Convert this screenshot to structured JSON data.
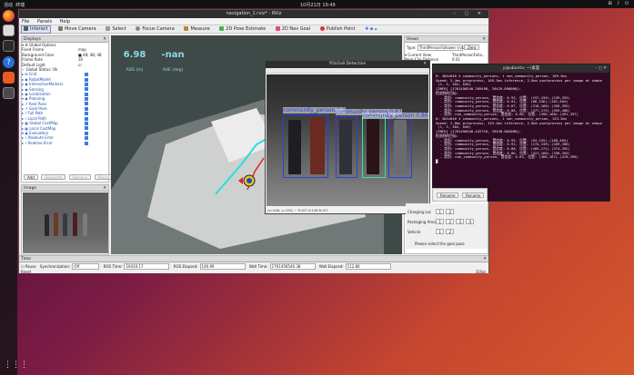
{
  "topbar": {
    "activities": "活动",
    "app": "终端",
    "clock": "10月21日 19:49",
    "tray": "⊞ ♪ ⏻"
  },
  "dock": {
    "apps_grid": "⋮⋮⋮"
  },
  "rviz": {
    "title": "navigation_1.rviz* - RViz",
    "window_controls": "– ▢ ✕",
    "menu": [
      "File",
      "Panels",
      "Help"
    ],
    "toolbar": [
      "Interact",
      "Move Camera",
      "Select",
      "Focus Camera",
      "Measure",
      "2D Pose Estimate",
      "2D Nav Goal",
      "Publish Point"
    ],
    "displays": {
      "title": "Displays",
      "rows": [
        {
          "label": "▾ ⚙ Global Options",
          "val": ""
        },
        {
          "label": "      Fixed Frame",
          "val": "map"
        },
        {
          "label": "      Background Color",
          "val": "■ 48; 48; 48"
        },
        {
          "label": "      Frame Rate",
          "val": "30"
        },
        {
          "label": "      Default Light",
          "val": "☑"
        },
        {
          "label": "  ✓ Global Status: Ok",
          "val": ""
        },
        {
          "label": "▸ ⊞ Grid",
          "val": ""
        },
        {
          "label": "▸ ◉ RobotModel",
          "val": ""
        },
        {
          "label": "▸ ◉ InteractiveMarkers",
          "val": ""
        },
        {
          "label": "▸ ◉ Sensing",
          "val": ""
        },
        {
          "label": "▸ ◉ Localization",
          "val": ""
        },
        {
          "label": "▾ ◉ Planning",
          "val": ""
        },
        {
          "label": "    ▸ ↗ Real Pose",
          "val": ""
        },
        {
          "label": "    ▸ ↗ Goal Pose",
          "val": ""
        },
        {
          "label": "    ▸ ⌇ Full Path",
          "val": ""
        },
        {
          "label": "    ▸ ⌇ Local Path",
          "val": ""
        },
        {
          "label": "    ▸ ▦ Global CostMap",
          "val": ""
        },
        {
          "label": "    ▸ ▦ Local CostMap",
          "val": ""
        },
        {
          "label": "▾ ◉ Evaluation",
          "val": ""
        },
        {
          "label": "    ▸ ⌇ Absolute Error",
          "val": ""
        },
        {
          "label": "    ▸ ⌇ Relative Error",
          "val": ""
        }
      ],
      "buttons": [
        "Add",
        "Duplicate",
        "Remove",
        "Rename"
      ]
    },
    "image_panel": {
      "title": "Image"
    },
    "view3d": {
      "speed": "6.98",
      "speed_unit": "ADS (m)",
      "angle": "-nan",
      "angle_unit": "AHE (deg)"
    },
    "views": {
      "title": "Views",
      "type_label": "Type:",
      "type_value": "ThirdPersonFollower (rviz)",
      "zero": "Zero",
      "rows": [
        {
          "label": "▾ Current View",
          "val": "ThirdPersonFollo..."
        },
        {
          "label": "   Near Clip Distance",
          "val": "0.01"
        },
        {
          "label": "   Invert Z Axis",
          "val": "☐"
        },
        {
          "label": "   Target Frame",
          "val": "base_link"
        },
        {
          "label": "   Distance",
          "val": "25.92"
        }
      ]
    },
    "time": {
      "title": "Time",
      "pause": "Pause",
      "sync_label": "Synchronization:",
      "sync_value": "Off",
      "ros_time_label": "ROS Time:",
      "ros_time": "19410.17",
      "ros_elapsed_label": "ROS Elapsed:",
      "ros_elapsed": "140.99",
      "wall_time_label": "Wall Time:",
      "wall_time": "1761456540.38",
      "wall_elapsed_label": "Wall Elapsed:",
      "wall_elapsed": "112.80",
      "reset": "Reset",
      "fps": "31fps"
    }
  },
  "yolo": {
    "title": "YOLOv8 Detection",
    "close": "✕",
    "labels": [
      "community_person 0.9",
      "community_person 0.87",
      "community_person 0.86"
    ],
    "status": "(x=406, y=191) ~ R:107 G:106 B:107"
  },
  "terminal": {
    "title": "y@ubuntu: ~/桌面",
    "controls": "– ▢ ✕",
    "lines": [
      "0: 384x640 4 community_persons, 1 non_community_person, 169.3ms",
      "Speed: 3.4ms preprocess, 169.3ms inference, 2.6ms postprocess per image at shape",
      " (1, 3, 384, 640)",
      "[INFO] [1761456540.289498, 19429.090000]:",
      "检测到的目标:",
      "  - 类别: community_person, 置信度: 0.93, 位置: (197,159)-(239,393)",
      "  - 类别: community_person, 置信度: 0.91, 位置: (88,156)-(181,404)",
      "  - 类别: community_person, 置信度: 0.87, 位置: (318,160)-(356,395)",
      "  - 类别: community_person, 置信度: 0.86, 位置: (377,173)-(455,400)",
      "  - 类别: non_community_person, 置信度: 0.66, 位置: (396,168)-(491,397)",
      "",
      "0: 384x640 4 community_persons, 1 non_community_person, 153.3ms",
      "Speed: 2.0ms preprocess, 153.3ms inference, 2.0ms postprocess per image at shape",
      " (1, 3, 384, 640)",
      "[INFO] [1761456540.442716, 19430.064000]:",
      "检测到的目标:",
      "  - 类别: community_person, 置信度: 0.93, 位置: (94,155)-(180,405)",
      "  - 类别: community_person, 置信度: 0.91, 位置: (174,139)-(269,396)",
      "  - 类别: community_person, 置信度: 0.88, 位置: (409,171)-(374,392)",
      "  - 类别: community_person, 置信度: 0.86, 位置: (321,160)-(358,394)",
      "  - 类别: non_community_person, 置信度: 0.63, 位置: (366,167)-(470,398)",
      "█"
    ]
  },
  "dialog": {
    "buttons": [
      "Rename",
      "Rename"
    ]
  },
  "goal": {
    "rows": [
      {
        "label": "Charging Loc",
        "buttons": [
          "1",
          "2"
        ]
      },
      {
        "label": "Packaging Area",
        "buttons": [
          "1",
          "2",
          "3",
          "4"
        ]
      },
      {
        "label": "Vehicle",
        "buttons": [
          "1",
          "2"
        ]
      }
    ],
    "prompt": "Please select the goal pose"
  }
}
